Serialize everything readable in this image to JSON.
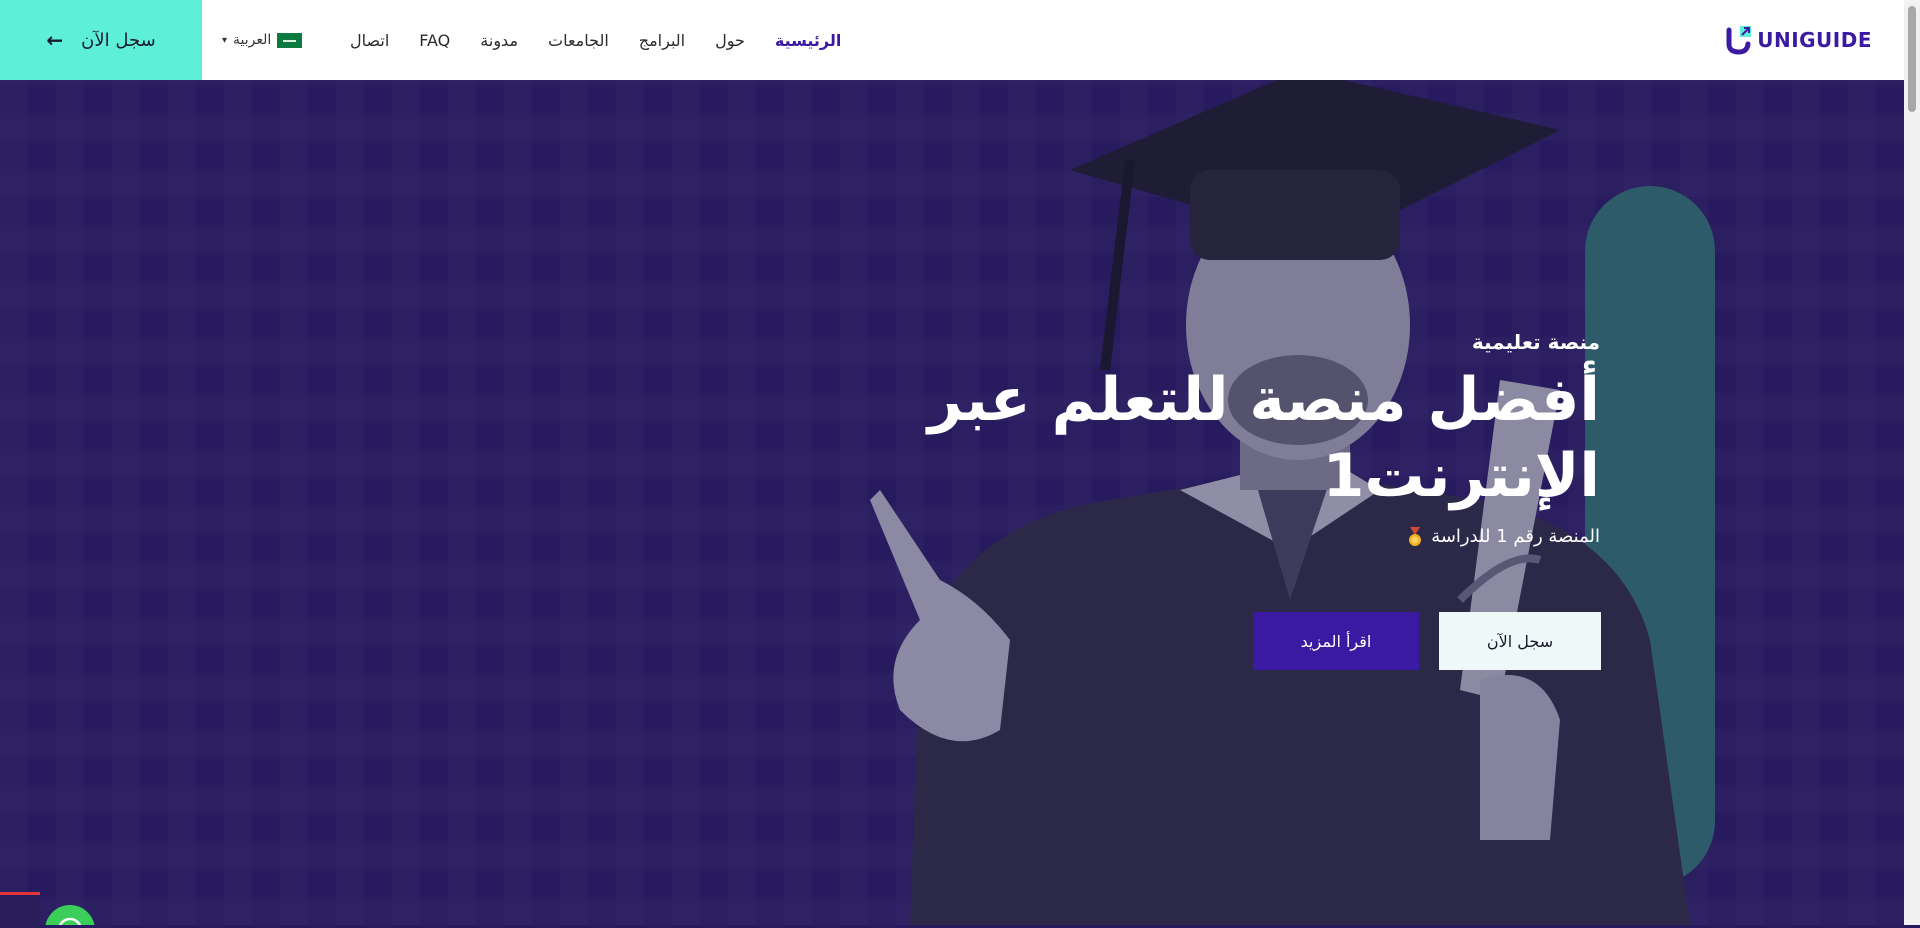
{
  "header": {
    "cta_label": "سجل الآن",
    "language": "العربية",
    "nav": [
      "اتصال",
      "FAQ",
      "مدونة",
      "الجامعات",
      "البرامج",
      "حول",
      "الرئيسية"
    ],
    "logo_text": "UNIGUIDE"
  },
  "hero": {
    "eyebrow": "منصة تعليمية",
    "headline": "أفضل منصة للتعلم عبر الإنترنت1",
    "subtitle": "المنصة رقم 1 للدراسة",
    "btn_read_more": "اقرأ المزيد",
    "btn_register": "سجل الآن"
  },
  "colors": {
    "brand": "#3b1aa3",
    "accent": "#5eefd8",
    "hero_bg": "#271a5e"
  }
}
